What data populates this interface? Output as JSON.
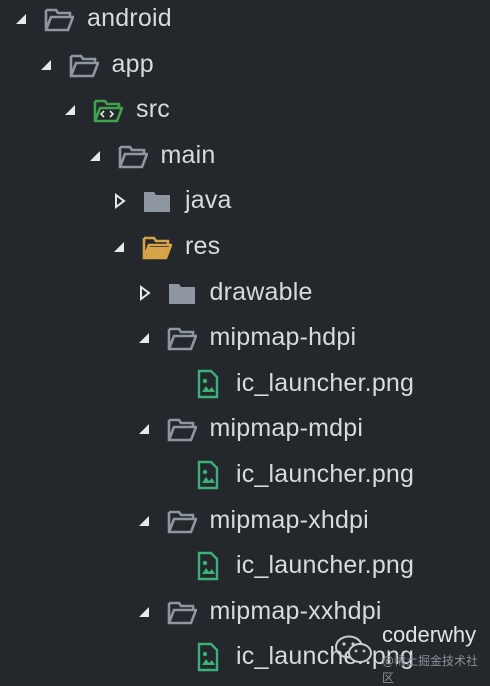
{
  "tree": [
    {
      "label": "android",
      "depth": 0,
      "kind": "folder",
      "state": "expanded",
      "icon": "folder-open-icon"
    },
    {
      "label": "app",
      "depth": 1,
      "kind": "folder",
      "state": "expanded",
      "icon": "folder-open-icon"
    },
    {
      "label": "src",
      "depth": 2,
      "kind": "folder",
      "state": "expanded",
      "icon": "source-folder-icon"
    },
    {
      "label": "main",
      "depth": 3,
      "kind": "folder",
      "state": "expanded",
      "icon": "folder-open-icon"
    },
    {
      "label": "java",
      "depth": 4,
      "kind": "folder",
      "state": "collapsed",
      "icon": "folder-icon"
    },
    {
      "label": "res",
      "depth": 4,
      "kind": "folder",
      "state": "expanded",
      "icon": "resource-folder-icon"
    },
    {
      "label": "drawable",
      "depth": 5,
      "kind": "folder",
      "state": "collapsed",
      "icon": "folder-icon"
    },
    {
      "label": "mipmap-hdpi",
      "depth": 5,
      "kind": "folder",
      "state": "expanded",
      "icon": "folder-open-icon"
    },
    {
      "label": "ic_launcher.png",
      "depth": 6,
      "kind": "file",
      "icon": "image-file-icon"
    },
    {
      "label": "mipmap-mdpi",
      "depth": 5,
      "kind": "folder",
      "state": "expanded",
      "icon": "folder-open-icon"
    },
    {
      "label": "ic_launcher.png",
      "depth": 6,
      "kind": "file",
      "icon": "image-file-icon"
    },
    {
      "label": "mipmap-xhdpi",
      "depth": 5,
      "kind": "folder",
      "state": "expanded",
      "icon": "folder-open-icon"
    },
    {
      "label": "ic_launcher.png",
      "depth": 6,
      "kind": "file",
      "icon": "image-file-icon"
    },
    {
      "label": "mipmap-xxhdpi",
      "depth": 5,
      "kind": "folder",
      "state": "expanded",
      "icon": "folder-open-icon"
    },
    {
      "label": "ic_launcher.png",
      "depth": 6,
      "kind": "file",
      "icon": "image-file-icon"
    }
  ],
  "colors": {
    "background": "#24272b",
    "text": "#d7dadf",
    "arrow": "#e6e8eb",
    "folder": "#8e97a1",
    "source_folder": "#3fa34d",
    "resource_folder": "#d7a44a",
    "image_file": "#3bb07a"
  },
  "watermark": {
    "name": "coderwhy",
    "subtitle": "@稀土掘金技术社区",
    "icon": "wechat-icon"
  }
}
